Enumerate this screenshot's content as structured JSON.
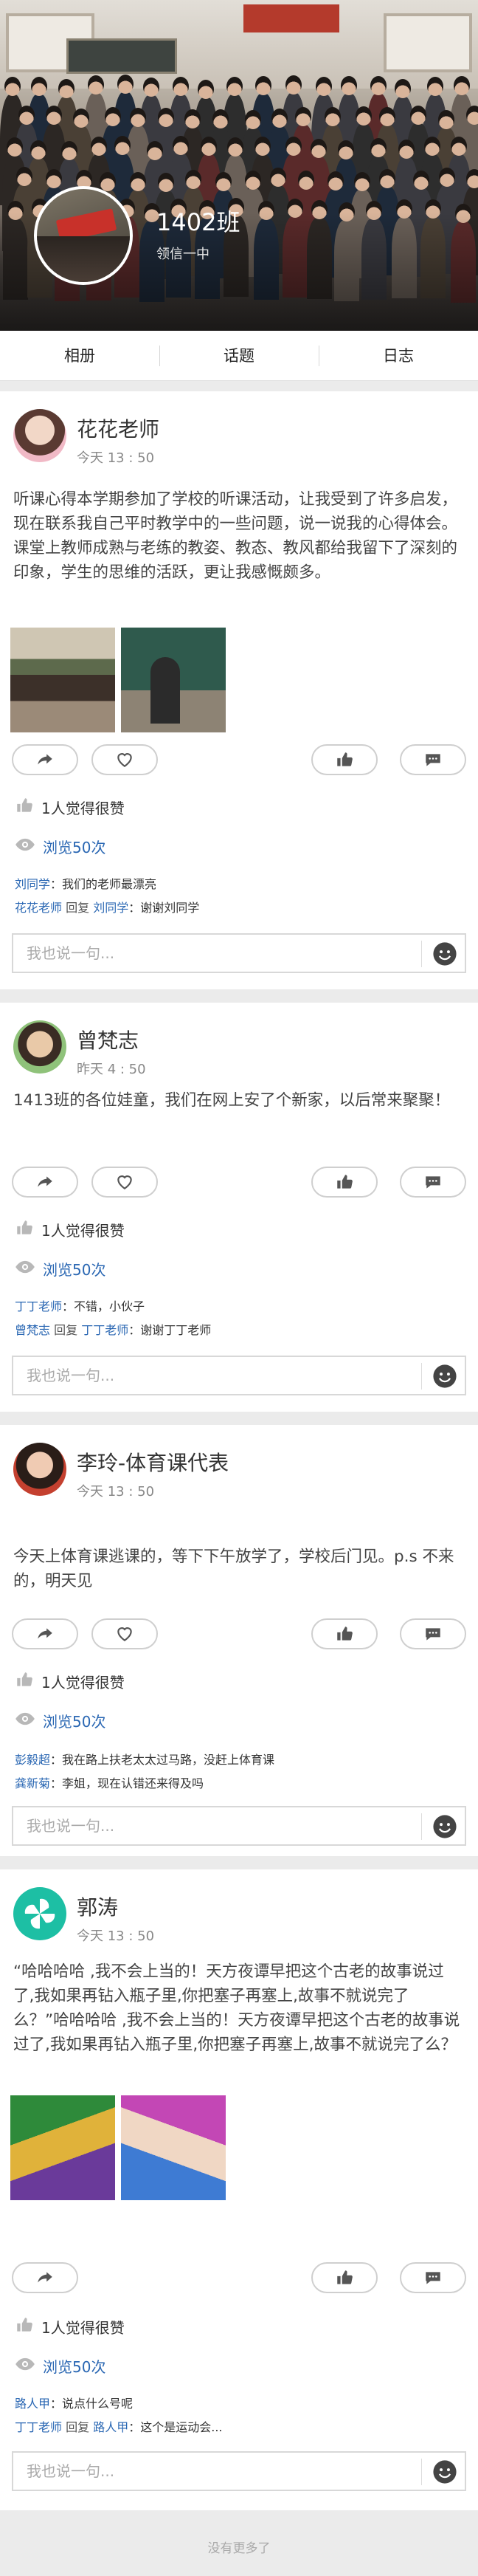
{
  "header": {
    "class_name": "1402班",
    "school": "领信一中"
  },
  "tabs": [
    {
      "label": "相册"
    },
    {
      "label": "话题"
    },
    {
      "label": "日志"
    }
  ],
  "comment_placeholder": "我也说一句...",
  "posts": [
    {
      "author": "花花老师",
      "time": "今天 13 : 50",
      "text": "听课心得本学期参加了学校的听课活动，让我受到了许多启发，现在联系我自己平时教学中的一些问题，说一说我的心得体会。课堂上教师成熟与老练的教姿、教态、教风都给我留下了深刻的印象，学生的思维的活跃，更让我感慨颇多。",
      "likes": "1人觉得很赞",
      "views": "浏览50次",
      "comments": [
        {
          "user": "刘同学",
          "content": "我们的老师最漂亮"
        },
        {
          "user": "花花老师",
          "reply_word": "回复",
          "to": "刘同学",
          "content": "谢谢刘同学"
        }
      ]
    },
    {
      "author": "曾梵志",
      "time": "昨天 4 : 50",
      "text": "1413班的各位娃童，我们在网上安了个新家，以后常来聚聚！",
      "likes": "1人觉得很赞",
      "views": "浏览50次",
      "comments": [
        {
          "user": "丁丁老师",
          "content": "不错，小伙子"
        },
        {
          "user": "曾梵志",
          "reply_word": "回复",
          "to": "丁丁老师",
          "content": "谢谢丁丁老师"
        }
      ]
    },
    {
      "author": "李玲-体育课代表",
      "time": "今天 13 : 50",
      "text": "今天上体育课逃课的，等下下午放学了，学校后门见。p.s 不来的，明天见",
      "likes": "1人觉得很赞",
      "views": "浏览50次",
      "comments": [
        {
          "user": "彭毅超",
          "content": "我在路上扶老太太过马路，没赶上体育课"
        },
        {
          "user": "龚新菊",
          "content": "李姐，现在认错还来得及吗"
        }
      ]
    },
    {
      "author": "郭涛",
      "time": "今天 13 : 50",
      "text": "“哈哈哈哈 ,我不会上当的！天方夜谭早把这个古老的故事说过了,我如果再钻入瓶子里,你把塞子再塞上,故事不就说完了么？”哈哈哈哈 ,我不会上当的！天方夜谭早把这个古老的故事说过了,我如果再钻入瓶子里,你把塞子再塞上,故事不就说完了么？",
      "likes": "1人觉得很赞",
      "views": "浏览50次",
      "comments": [
        {
          "user": "路人甲",
          "content": "说点什么号呢"
        },
        {
          "user": "丁丁老师",
          "reply_word": "回复",
          "to": "路人甲",
          "content": "这个是运动会..."
        }
      ]
    }
  ],
  "load_more": "没有更多了",
  "colors": {
    "link_blue": "#2a67b3",
    "teal_avatar": "#1dbfa4"
  }
}
